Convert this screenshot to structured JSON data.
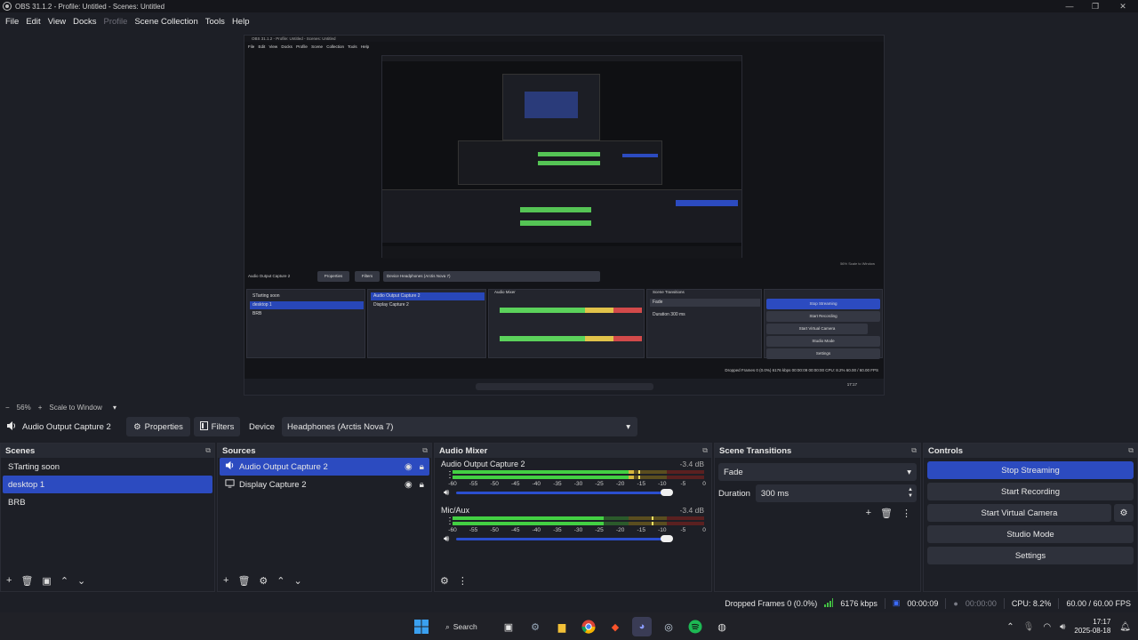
{
  "window": {
    "title": "OBS 31.1.2 - Profile: Untitled - Scenes: Untitled",
    "minimize": "—",
    "maximize": "❐",
    "close": "✕"
  },
  "menu": [
    {
      "label": "File",
      "enabled": true
    },
    {
      "label": "Edit",
      "enabled": true
    },
    {
      "label": "View",
      "enabled": true
    },
    {
      "label": "Docks",
      "enabled": true
    },
    {
      "label": "Profile",
      "enabled": false
    },
    {
      "label": "Scene Collection",
      "enabled": true
    },
    {
      "label": "Tools",
      "enabled": true
    },
    {
      "label": "Help",
      "enabled": true
    }
  ],
  "preview": {
    "inner_title": "OBS 31.1.2 - Profile: Untitled - Scenes: Untitled",
    "inner_menu": "File Edit View Docks Profile Scene Collection Tools Help",
    "inner_status": "Dropped Frames 0 (0.0%)  6176 kbps  00:00:09  00:00:00  CPU: 8.2%  60.00 / 60.00 FPS",
    "inner_scenes": [
      "STarting soon",
      "desktop 1",
      "BRB"
    ],
    "inner_sources": [
      "Audio Output Capture 2",
      "Display Capture 2"
    ],
    "inner_controls": [
      "Stop Streaming",
      "Start Recording",
      "Start Virtual Camera",
      "Studio Mode",
      "Settings"
    ],
    "inner_zoom": "56%  Scale to Window",
    "inner_src_name": "Audio Output Capture 2",
    "inner_props": "Properties",
    "inner_filters": "Filters",
    "inner_device": "Device   Headphones (Arctis Nova 7)",
    "inner_mixer": "Audio Mixer",
    "inner_transitions": "Scene Transitions",
    "inner_fade": "Fade",
    "inner_duration": "Duration   300 ms",
    "inner_clock": "17:17"
  },
  "zoom": {
    "minus": "−",
    "level": "56%",
    "plus": "+",
    "mode": "Scale to Window",
    "chevron": "▾"
  },
  "source_toolbar": {
    "source_name": "Audio Output Capture 2",
    "properties_label": "Properties",
    "filters_label": "Filters",
    "device_label": "Device",
    "device_value": "Headphones (Arctis Nova 7)"
  },
  "scenes": {
    "title": "Scenes",
    "items": [
      "STarting soon",
      "desktop 1",
      "BRB"
    ],
    "selected_index": 1
  },
  "sources": {
    "title": "Sources",
    "items": [
      {
        "label": "Audio Output Capture 2",
        "icon": "speaker-icon",
        "selected": true
      },
      {
        "label": "Display Capture 2",
        "icon": "monitor-icon",
        "selected": false
      }
    ]
  },
  "mixer": {
    "title": "Audio Mixer",
    "scale": [
      "-60",
      "-55",
      "-50",
      "-45",
      "-40",
      "-35",
      "-30",
      "-25",
      "-20",
      "-15",
      "-10",
      "-5",
      "0"
    ],
    "channels": [
      {
        "name": "Audio Output Capture 2",
        "db": "-3.4 dB",
        "level": 0.72,
        "peak": 0.74,
        "volume": 1.0
      },
      {
        "name": "Mic/Aux",
        "db": "-3.4 dB",
        "level": 0.6,
        "peak": 0.79,
        "volume": 1.0
      }
    ]
  },
  "transitions": {
    "title": "Scene Transitions",
    "selected": "Fade",
    "duration_label": "Duration",
    "duration_value": "300 ms"
  },
  "controls": {
    "title": "Controls",
    "stop_streaming": "Stop Streaming",
    "start_recording": "Start Recording",
    "start_virtual_camera": "Start Virtual Camera",
    "studio_mode": "Studio Mode",
    "settings": "Settings"
  },
  "status": {
    "dropped_frames": "Dropped Frames 0 (0.0%)",
    "bitrate": "6176 kbps",
    "stream_time": "00:00:09",
    "record_time": "00:00:00",
    "cpu": "CPU: 8.2%",
    "fps": "60.00 / 60.00 FPS",
    "live_color": "#3b6cff",
    "bitrate_color": "#43c243"
  },
  "taskbar": {
    "search_label": "Search",
    "time": "17:17",
    "date": "2025-08-18"
  },
  "colors": {
    "accent": "#2c4bc0",
    "meter_green": "#43d043",
    "meter_yellow": "#d6b73c",
    "meter_red": "#c33b3b",
    "background": "#1d1f26"
  }
}
